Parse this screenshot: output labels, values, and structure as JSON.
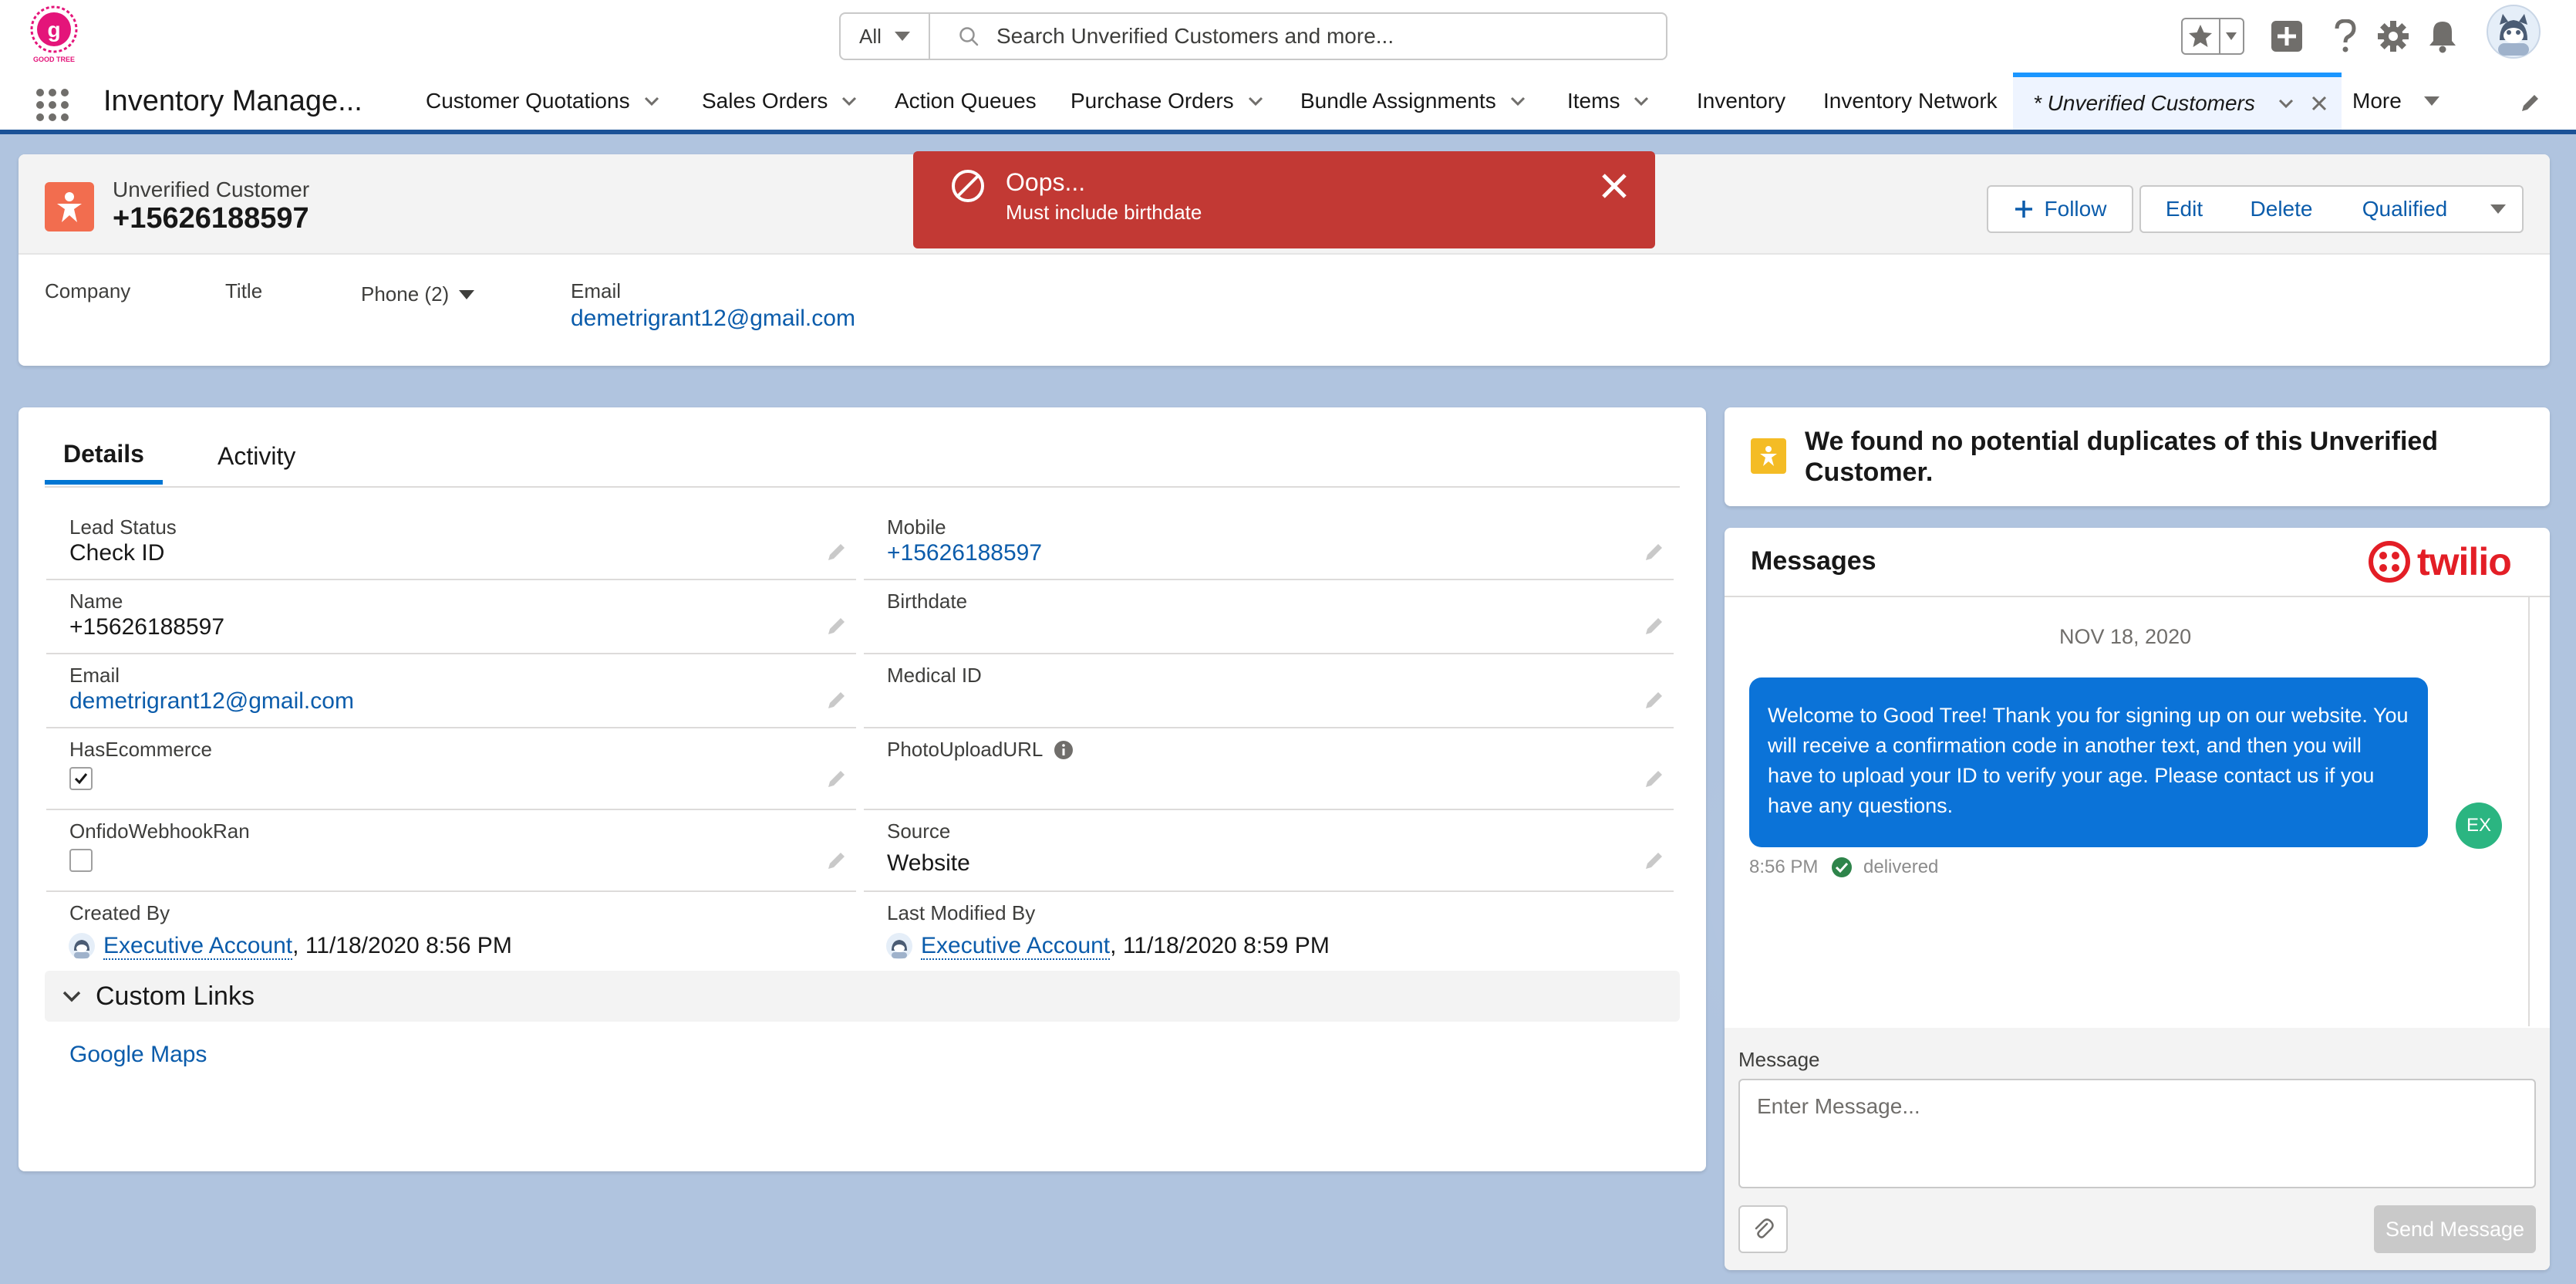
{
  "header": {
    "logo_text": "GOOD TREE",
    "search_scope": "All",
    "search_placeholder": "Search Unverified Customers and more..."
  },
  "nav": {
    "app_name": "Inventory Manage...",
    "items": [
      {
        "label": "Customer Quotations",
        "has_menu": true
      },
      {
        "label": "Sales Orders",
        "has_menu": true
      },
      {
        "label": "Action Queues",
        "has_menu": false
      },
      {
        "label": "Purchase Orders",
        "has_menu": true
      },
      {
        "label": "Bundle Assignments",
        "has_menu": true
      },
      {
        "label": "Items",
        "has_menu": true
      },
      {
        "label": "Inventory",
        "has_menu": false
      },
      {
        "label": "Inventory Network",
        "has_menu": false
      }
    ],
    "active_tab": "* Unverified Customers",
    "more_label": "More"
  },
  "record": {
    "type_label": "Unverified Customer",
    "name": "+15626188597",
    "buttons": {
      "follow": "Follow",
      "edit": "Edit",
      "delete": "Delete",
      "qualified": "Qualified"
    },
    "highlights": {
      "company_label": "Company",
      "title_label": "Title",
      "phone_label": "Phone (2)",
      "email_label": "Email",
      "email_value": "demetrigrant12@gmail.com"
    }
  },
  "toast": {
    "title": "Oops...",
    "message": "Must include birthdate",
    "color": "#c23934"
  },
  "details": {
    "tabs": [
      "Details",
      "Activity"
    ],
    "fields_left": [
      {
        "label": "Lead Status",
        "value": "Check ID"
      },
      {
        "label": "Name",
        "value": "+15626188597"
      },
      {
        "label": "Email",
        "value": "demetrigrant12@gmail.com"
      },
      {
        "label": "HasEcommerce",
        "checked": true
      },
      {
        "label": "OnfidoWebhookRan",
        "checked": false
      },
      {
        "label": "Created By",
        "user": "Executive Account",
        "datetime": ", 11/18/2020 8:56 PM"
      }
    ],
    "fields_right": [
      {
        "label": "Mobile",
        "value": "+15626188597"
      },
      {
        "label": "Birthdate",
        "value": ""
      },
      {
        "label": "Medical ID",
        "value": ""
      },
      {
        "label": "PhotoUploadURL",
        "value": ""
      },
      {
        "label": "Source",
        "value": "Website"
      },
      {
        "label": "Last Modified By",
        "user": "Executive Account",
        "datetime": ", 11/18/2020 8:59 PM"
      }
    ],
    "custom_links_label": "Custom Links",
    "custom_links": [
      "Google Maps"
    ]
  },
  "duplicates": {
    "text": "We found no potential duplicates of this Unverified Customer."
  },
  "messages": {
    "title": "Messages",
    "brand": "twilio",
    "date": "NOV 18, 2020",
    "bubble_text": "Welcome to Good Tree! Thank you for signing up on our website. You will receive a confirmation code in another text, and then you will have to upload your ID to verify your age. Please contact us if you have any questions.",
    "avatar_initials": "EX",
    "time": "8:56 PM",
    "status": "delivered",
    "composer_label": "Message",
    "composer_placeholder": "Enter Message...",
    "send_label": "Send Message"
  },
  "colors": {
    "brand_blue": "#0176d3",
    "link_blue": "#0b5cab",
    "error_red": "#c23934",
    "record_icon": "#f26d4f",
    "bubble_blue": "#0b73d8",
    "delivered_green": "#2e844a"
  }
}
